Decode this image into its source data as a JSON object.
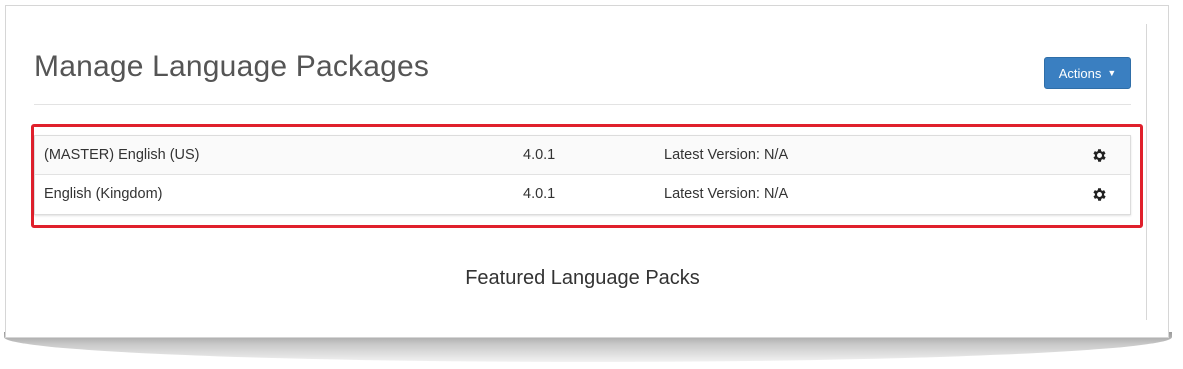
{
  "page": {
    "title": "Manage Language Packages",
    "actions_label": "Actions"
  },
  "packages": [
    {
      "name": "(MASTER) English (US)",
      "version": "4.0.1",
      "latest": "Latest Version: N/A",
      "icon": "gear-icon"
    },
    {
      "name": "English (Kingdom)",
      "version": "4.0.1",
      "latest": "Latest Version: N/A",
      "icon": "gear-icon"
    }
  ],
  "featured": {
    "heading": "Featured Language Packs"
  },
  "colors": {
    "accent": "#3a7fc1",
    "highlight": "#e0202c",
    "text": "#333333",
    "title": "#555555"
  }
}
